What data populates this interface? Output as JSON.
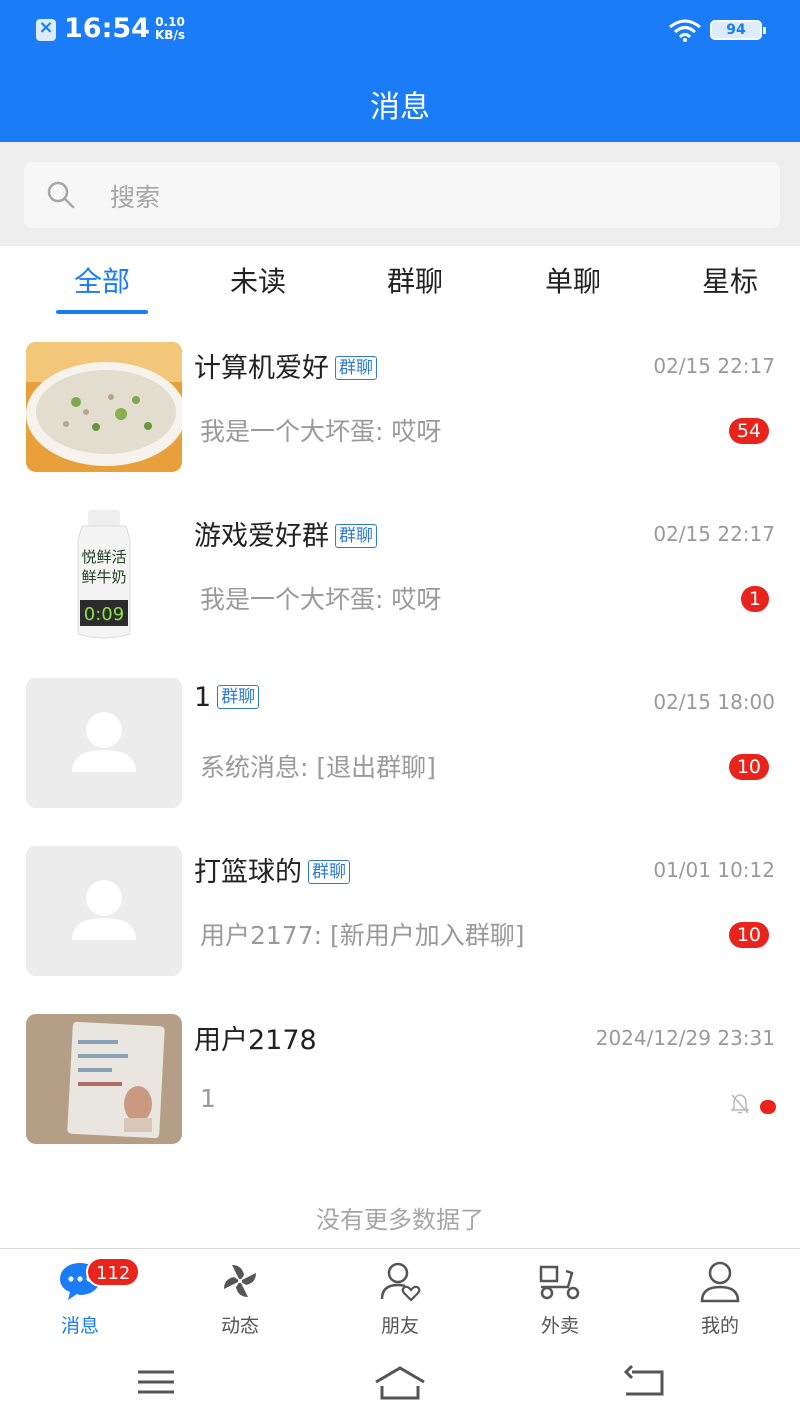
{
  "status_bar": {
    "time": "16:54",
    "net_speed_value": "0.10",
    "net_speed_unit": "KB/s",
    "battery": "94"
  },
  "header": {
    "title": "消息"
  },
  "search": {
    "placeholder": "搜索"
  },
  "tabs": [
    {
      "label": "全部",
      "active": true
    },
    {
      "label": "未读",
      "active": false
    },
    {
      "label": "群聊",
      "active": false
    },
    {
      "label": "单聊",
      "active": false
    },
    {
      "label": "星标",
      "active": false
    }
  ],
  "chats": [
    {
      "name": "计算机爱好",
      "tag": "群聊",
      "time": "02/15 22:17",
      "message": "我是一个大坏蛋: 哎呀",
      "unread": "54",
      "avatar": "porridge-photo"
    },
    {
      "name": "游戏爱好群",
      "tag": "群聊",
      "time": "02/15 22:17",
      "message": "我是一个大坏蛋: 哎呀",
      "unread": "1",
      "avatar": "milk-bottle-photo",
      "avatar_text": [
        "悦鲜活",
        "鲜牛奶",
        "0:09"
      ]
    },
    {
      "name": "1",
      "tag": "群聊",
      "time": "02/15 18:00",
      "message": "系统消息: [退出群聊]",
      "unread": "10",
      "avatar": "default-user"
    },
    {
      "name": "打篮球的",
      "tag": "群聊",
      "time": "01/01 10:12",
      "message": "用户2177: [新用户加入群聊]",
      "unread": "10",
      "avatar": "default-user"
    },
    {
      "name": "用户2178",
      "tag": "",
      "time": "2024/12/29 23:31",
      "message": "1",
      "unread": "",
      "muted": true,
      "avatar": "id-card-photo"
    }
  ],
  "list_footer": "没有更多数据了",
  "bottom_nav": [
    {
      "label": "消息",
      "icon": "chat-bubble-icon",
      "badge": "112",
      "active": true
    },
    {
      "label": "动态",
      "icon": "pinwheel-icon",
      "active": false
    },
    {
      "label": "朋友",
      "icon": "friend-heart-icon",
      "active": false
    },
    {
      "label": "外卖",
      "icon": "scooter-icon",
      "active": false
    },
    {
      "label": "我的",
      "icon": "person-icon",
      "active": false
    }
  ],
  "colors": {
    "primary": "#1a7cf6",
    "badge": "#e8241c",
    "muted_text": "#9a9a9a",
    "search_bg": "#eeeeee"
  }
}
